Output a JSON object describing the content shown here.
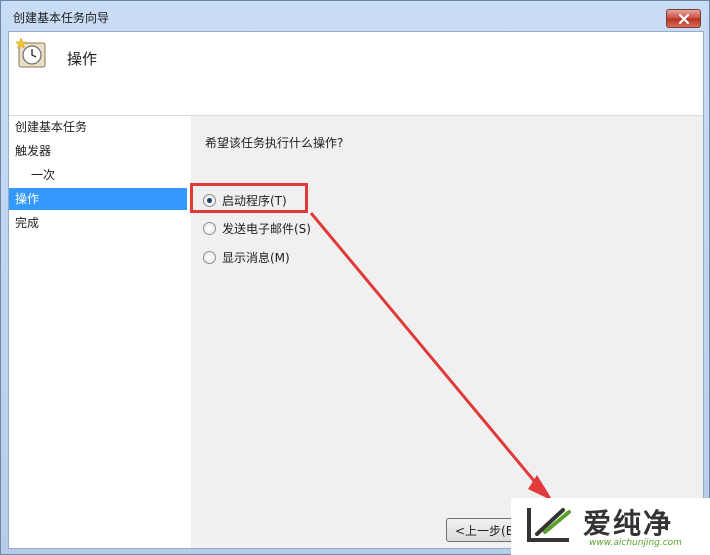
{
  "window": {
    "title": "创建基本任务向导",
    "close_label": "close"
  },
  "header": {
    "title": "操作",
    "icon": "clock-icon"
  },
  "nav": {
    "items": [
      {
        "label": "创建基本任务",
        "selected": false
      },
      {
        "label": "触发器",
        "selected": false
      },
      {
        "label": "一次",
        "selected": false
      },
      {
        "label": "操作",
        "selected": true
      },
      {
        "label": "完成",
        "selected": false
      }
    ]
  },
  "main": {
    "question": "希望该任务执行什么操作?",
    "options": [
      {
        "label": "启动程序(T)",
        "checked": true
      },
      {
        "label": "发送电子邮件(S)",
        "checked": false
      },
      {
        "label": "显示消息(M)",
        "checked": false
      }
    ]
  },
  "buttons": {
    "back_label": "<上一步(B"
  },
  "watermark": {
    "name": "爱纯净",
    "url": "www.aichunjing.com"
  },
  "colors": {
    "selection": "#3399ff",
    "highlight": "#e03a3a",
    "watermark_green": "#5aa02c"
  }
}
